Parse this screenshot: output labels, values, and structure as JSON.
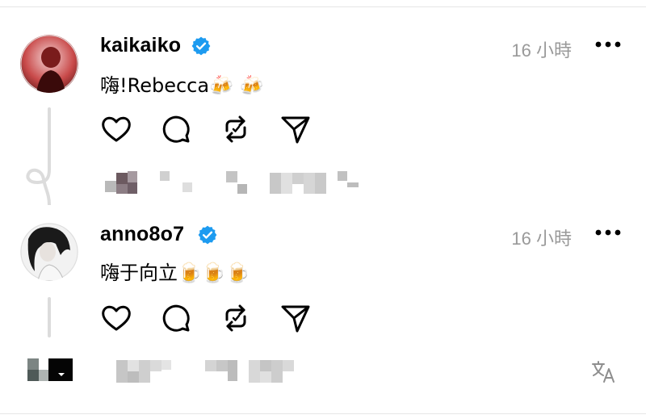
{
  "posts": [
    {
      "username": "kaikaiko",
      "time": "16 小時",
      "content": "嗨!Rebecca🍻 🍻",
      "verified": true
    },
    {
      "username": "anno8o7",
      "time": "16 小時",
      "content": "嗨于向立🍺🍺🍺",
      "verified": true
    }
  ],
  "icons": {
    "verified": "verified-badge-icon",
    "more": "more-options-icon",
    "like": "heart-icon",
    "comment": "comment-bubble-icon",
    "repost": "repost-icon",
    "share": "send-icon",
    "translate": "translate-icon"
  },
  "colors": {
    "verified": "#1d9bf0",
    "time": "#999999",
    "thread_line": "#dcdcdc"
  }
}
